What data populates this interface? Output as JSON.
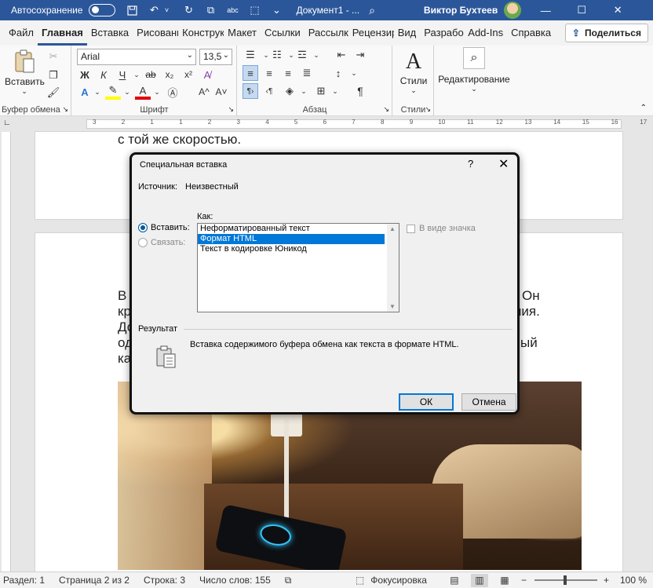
{
  "titlebar": {
    "autosave_label": "Автосохранение",
    "doc_title": "Документ1 - ...",
    "user_name": "Виктор Бухтеев",
    "quick_icons": [
      "save-icon",
      "undo-icon",
      "redo-icon",
      "refresh-icon",
      "spelling-icon",
      "format-painter-icon",
      "more-icon"
    ]
  },
  "tabs": {
    "items": [
      "Файл",
      "Главная",
      "Вставка",
      "Рисовани",
      "Конструк",
      "Макет",
      "Ссылки",
      "Рассылки",
      "Рецензир",
      "Вид",
      "Разрабо",
      "Add-Ins",
      "Справка"
    ],
    "active": "Главная",
    "share_label": "Поделиться"
  },
  "ribbon": {
    "clipboard": {
      "paste_label": "Вставить",
      "group_label": "Буфер обмена"
    },
    "font": {
      "font_name": "Arial",
      "font_size": "13,5",
      "bold": "Ж",
      "italic": "К",
      "underline": "Ч",
      "strike": "ab",
      "subscript": "x₂",
      "superscript": "x²",
      "grow": "A^",
      "shrink": "A˅",
      "group_label": "Шрифт"
    },
    "paragraph": {
      "group_label": "Абзац"
    },
    "styles": {
      "label": "Стили",
      "group_label": "Стили"
    },
    "editing": {
      "label": "Редактирование"
    }
  },
  "ruler": {
    "ticks": [
      "3",
      "2",
      "1",
      "1",
      "2",
      "3",
      "4",
      "5",
      "6",
      "7",
      "8",
      "9",
      "10",
      "11",
      "12",
      "13",
      "14",
      "15",
      "16",
      "17"
    ]
  },
  "document": {
    "page1_text": "с той же скоростью.",
    "page2_lines": [
      {
        "left": "В",
        "right": "Он"
      },
      {
        "left": "кр",
        "right": "ния."
      },
      {
        "left": "До",
        "right": ""
      },
      {
        "left": "од",
        "right": "ый"
      },
      {
        "left": "ка",
        "right": ""
      }
    ]
  },
  "dialog": {
    "title": "Специальная вставка",
    "help": "?",
    "close": "✕",
    "source_label": "Источник:",
    "source_value": "Неизвестный",
    "paste_radio": "Вставить:",
    "link_radio": "Связать:",
    "as_label": "Как:",
    "options": [
      "Неформатированный текст",
      "Формат HTML",
      "Текст в кодировке Юникод"
    ],
    "selected_option": "Формат HTML",
    "as_icon_label": "В виде значка",
    "result_label": "Результат",
    "result_text": "Вставка содержимого буфера обмена как текста в формате HTML.",
    "ok_label": "ОК",
    "cancel_label": "Отмена"
  },
  "status": {
    "section": "Раздел: 1",
    "page": "Страница 2 из 2",
    "line": "Строка: 3",
    "words": "Число слов: 155",
    "focus": "Фокусировка",
    "zoom": "100 %",
    "zoom_level": 100
  },
  "colors": {
    "titlebar": "#2b579a",
    "accent": "#0078d7",
    "highlight": "#ffff00",
    "font_color": "#e00000"
  }
}
